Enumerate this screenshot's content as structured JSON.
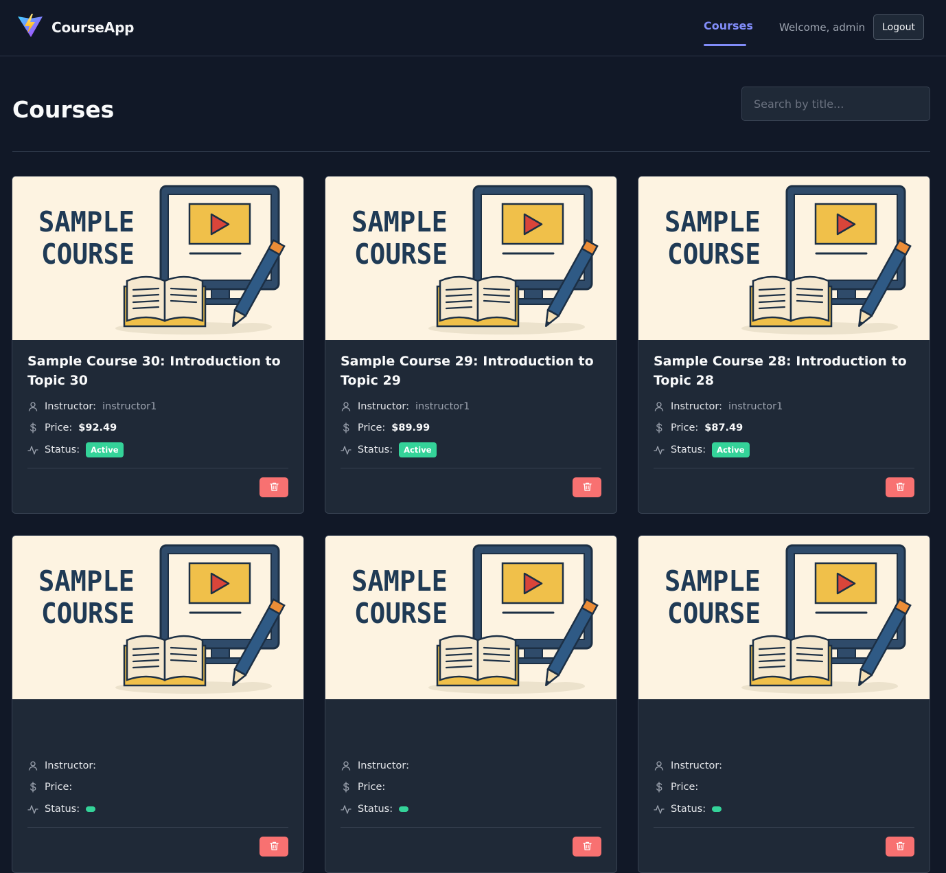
{
  "navbar": {
    "brand": "CourseApp",
    "links": [
      {
        "label": "Courses",
        "active": true
      }
    ],
    "welcome": "Welcome, admin",
    "logout_label": "Logout",
    "accent_color": "#818cf8"
  },
  "page": {
    "title": "Courses",
    "search": {
      "placeholder": "Search by title...",
      "value": ""
    }
  },
  "labels": {
    "instructor": "Instructor:",
    "price": "Price:",
    "status": "Status:"
  },
  "thumbnail": {
    "line1": "SAMPLE",
    "line2": "COURSE"
  },
  "courses": [
    {
      "title": "Sample Course 30: Introduction to Topic 30",
      "instructor": "instructor1",
      "price": "$92.49",
      "status": "Active"
    },
    {
      "title": "Sample Course 29: Introduction to Topic 29",
      "instructor": "instructor1",
      "price": "$89.99",
      "status": "Active"
    },
    {
      "title": "Sample Course 28: Introduction to Topic 28",
      "instructor": "instructor1",
      "price": "$87.49",
      "status": "Active"
    },
    {
      "title": "",
      "instructor": "",
      "price": "",
      "status": ""
    },
    {
      "title": "",
      "instructor": "",
      "price": "",
      "status": ""
    },
    {
      "title": "",
      "instructor": "",
      "price": "",
      "status": ""
    }
  ],
  "icons": {
    "instructor": "user-icon",
    "price": "dollar-icon",
    "status": "activity-icon",
    "delete": "trash-icon",
    "brand": "vite-logo-icon"
  },
  "colors": {
    "background": "#111827",
    "card": "#1f2937",
    "status_active": "#34d399",
    "delete": "#f87171"
  }
}
